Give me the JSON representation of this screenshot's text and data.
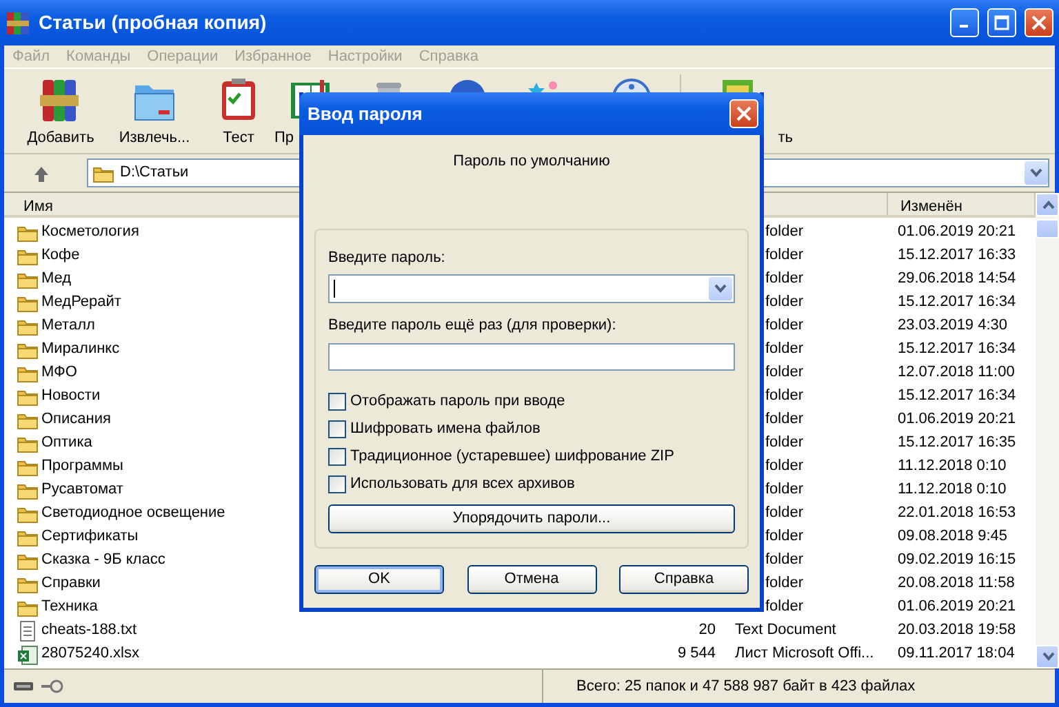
{
  "window": {
    "title": "Статьи (пробная копия)"
  },
  "menu": [
    "Файл",
    "Команды",
    "Операции",
    "Избранное",
    "Настройки",
    "Справка"
  ],
  "toolbar": {
    "labels": [
      "Добавить",
      "Извлечь...",
      "Тест",
      "Пр"
    ],
    "trailing_label": "ть"
  },
  "address": {
    "path": "D:\\Статьи"
  },
  "file_list": {
    "columns": [
      "Имя",
      "Изменён"
    ],
    "rows": [
      {
        "kind": "folder",
        "name": "Косметология",
        "type": "folder",
        "modified": "01.06.2019 20:21"
      },
      {
        "kind": "folder",
        "name": "Кофе",
        "type": "folder",
        "modified": "15.12.2017 16:33"
      },
      {
        "kind": "folder",
        "name": "Мед",
        "type": "folder",
        "modified": "29.06.2018 14:54"
      },
      {
        "kind": "folder",
        "name": "МедРерайт",
        "type": "folder",
        "modified": "15.12.2017 16:34"
      },
      {
        "kind": "folder",
        "name": "Металл",
        "type": "folder",
        "modified": "23.03.2019 4:30"
      },
      {
        "kind": "folder",
        "name": "Миралинкс",
        "type": "folder",
        "modified": "15.12.2017 16:34"
      },
      {
        "kind": "folder",
        "name": "МФО",
        "type": "folder",
        "modified": "12.07.2018 11:00"
      },
      {
        "kind": "folder",
        "name": "Новости",
        "type": "folder",
        "modified": "15.12.2017 16:34"
      },
      {
        "kind": "folder",
        "name": "Описания",
        "type": "folder",
        "modified": "01.06.2019 20:21"
      },
      {
        "kind": "folder",
        "name": "Оптика",
        "type": "folder",
        "modified": "15.12.2017 16:35"
      },
      {
        "kind": "folder",
        "name": "Программы",
        "type": "folder",
        "modified": "11.12.2018 0:10"
      },
      {
        "kind": "folder",
        "name": "Русавтомат",
        "type": "folder",
        "modified": "11.12.2018 0:10"
      },
      {
        "kind": "folder",
        "name": "Светодиодное освещение",
        "type": "folder",
        "modified": "22.01.2018 16:53"
      },
      {
        "kind": "folder",
        "name": "Сертификаты",
        "type": "folder",
        "modified": "09.08.2018 9:45"
      },
      {
        "kind": "folder",
        "name": "Сказка - 9Б класс",
        "type": "folder",
        "modified": "09.02.2019 16:15"
      },
      {
        "kind": "folder",
        "name": "Справки",
        "type": "folder",
        "modified": "20.08.2018 11:58"
      },
      {
        "kind": "folder",
        "name": "Техника",
        "type": "folder",
        "modified": "01.06.2019 20:21"
      },
      {
        "kind": "text",
        "name": "cheats-188.txt",
        "size": "20",
        "type": "Text Document",
        "modified": "20.03.2018 19:58"
      },
      {
        "kind": "sheet",
        "name": "28075240.xlsx",
        "size": "9 544",
        "type": "Лист Microsoft Offi...",
        "modified": "09.11.2017 18:04"
      }
    ]
  },
  "status_bar": {
    "text": "Всего: 25 папок и 47 588 987 байт в 423 файлах"
  },
  "dialog": {
    "title": "Ввод пароля",
    "subtitle": "Пароль по умолчанию",
    "password_label": "Введите пароль:",
    "confirm_label": "Введите пароль ещё раз (для проверки):",
    "checkboxes": [
      {
        "label": "Отображать пароль при вводе",
        "checked": false
      },
      {
        "label": "Шифровать имена файлов",
        "checked": false
      },
      {
        "label": "Традиционное (устаревшее) шифрование ZIP",
        "checked": false
      },
      {
        "label": "Использовать для всех архивов",
        "checked": false
      }
    ],
    "manage_button": "Упорядочить пароли...",
    "buttons": [
      "OK",
      "Отмена",
      "Справка"
    ]
  }
}
